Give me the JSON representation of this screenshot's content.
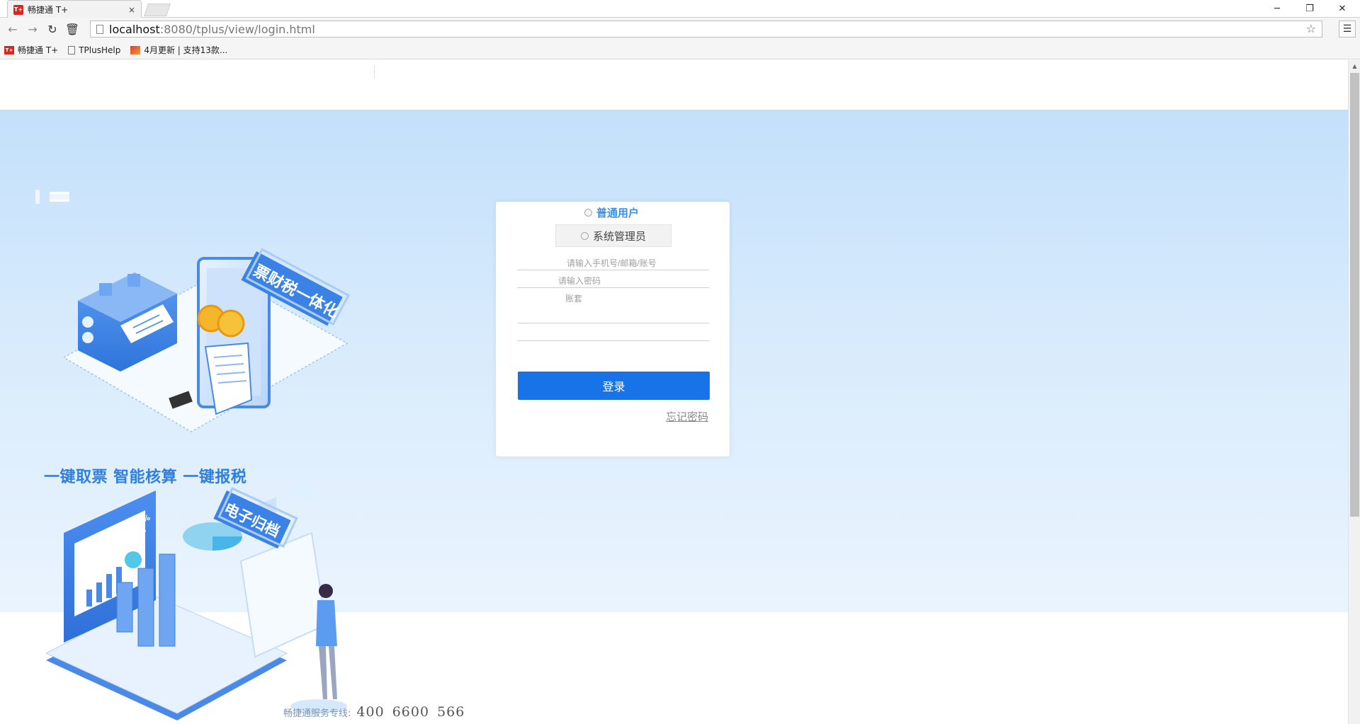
{
  "browser": {
    "tab_title": "畅捷通 T+",
    "tab_favicon_text": "T+",
    "tab_close": "×",
    "url_host": "localhost",
    "url_rest": ":8080/tplus/view/login.html",
    "window_controls": {
      "minimize": "─",
      "restore": "❐",
      "close": "✕"
    },
    "nav": {
      "back": "←",
      "forward": "→",
      "reload": "↻",
      "home": "🗑"
    },
    "bookmarks": [
      {
        "label": "畅捷通 T+",
        "icon": "t-plus-icon"
      },
      {
        "label": "TPlusHelp",
        "icon": "page-icon"
      },
      {
        "label": "4月更新 | 支持13款...",
        "icon": "image-icon"
      }
    ]
  },
  "hero": {
    "badge_top": "票财税一体化",
    "badge_bottom": "电子归档",
    "chart_percent": "80%",
    "chart_sub": "10%",
    "slogan": "一键取票 智能核算 一键报税",
    "hotline_label": "畅捷通服务专线:",
    "hotline_number": "400 6600 566"
  },
  "login": {
    "role_user": "普通用户",
    "role_admin": "系统管理员",
    "account_placeholder": "请输入手机号/邮箱/账号",
    "password_placeholder": "请输入密码",
    "ledger_placeholder": "账套",
    "submit": "登录",
    "forgot": "忘记密码"
  },
  "colors": {
    "accent": "#1873e8",
    "role_active": "#3d8eea",
    "hero_top": "#c3e0fb",
    "slogan": "#2f7fe0"
  }
}
